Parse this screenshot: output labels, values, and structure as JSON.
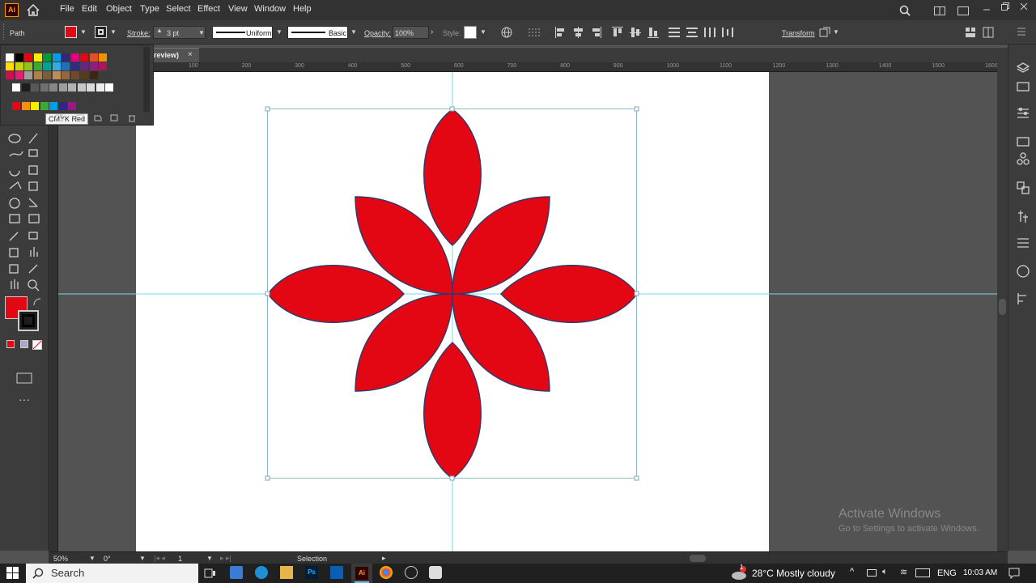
{
  "app": {
    "logo": "Ai",
    "home_icon": "home-icon"
  },
  "menu": [
    "File",
    "Edit",
    "Object",
    "Type",
    "Select",
    "Effect",
    "View",
    "Window",
    "Help"
  ],
  "control": {
    "selection_type": "Path",
    "fill_color": "#e30613",
    "stroke_label": "Stroke:",
    "stroke_weight": "3 pt",
    "profile_label": "Uniform",
    "brush_label": "Basic",
    "opacity_label": "Opacity:",
    "opacity_value": "100%",
    "style_label": "Style:",
    "transform_label": "Transform"
  },
  "document": {
    "tab_label": "review)"
  },
  "ruler": {
    "h_ticks": [
      "100",
      "200",
      "300",
      "400",
      "500",
      "600",
      "700",
      "800",
      "900",
      "1000",
      "1100",
      "1200",
      "1300",
      "1400",
      "1500",
      "1600"
    ]
  },
  "swatches": {
    "tooltip": "CMYK Red",
    "row1": [
      "#ffffff",
      "#000000",
      "#e30613",
      "#ffed00",
      "#00983a",
      "#009fe3",
      "#312783",
      "#e6007e",
      "#e30613",
      "#e94e1b",
      "#f39200"
    ],
    "row2": [
      "#ffdd00",
      "#c8d400",
      "#95c11f",
      "#3aaa35",
      "#00a19a",
      "#36a9e1",
      "#1d71b8",
      "#2d2e83",
      "#662483",
      "#951b81",
      "#a3195b"
    ],
    "row3": [
      "#d60b52",
      "#e71d73",
      "#9d9d9c",
      "#b17f4a",
      "#7c5c3b",
      "#be8d5a",
      "#95673e",
      "#6f4a2c",
      "#5a3a1f",
      "#3c2616"
    ],
    "row4": [
      "#ffffff",
      "#1d1d1b",
      "#575756",
      "#706f6f",
      "#878787",
      "#9d9d9c",
      "#b2b2b2",
      "#c6c6c5",
      "#dadada",
      "#ededed",
      "#ffffff"
    ],
    "row5": [
      "#e30613",
      "#f39200",
      "#ffed00",
      "#3aaa35",
      "#009fe3",
      "#312783",
      "#951b81"
    ]
  },
  "fill_swatch": "#e30613",
  "status": {
    "zoom": "50%",
    "rotation": "0°",
    "artboard_num": "1",
    "tool": "Selection"
  },
  "watermark": {
    "line1": "Activate Windows",
    "line2": "Go to Settings to activate Windows."
  },
  "taskbar": {
    "search_placeholder": "Search",
    "weather": "28°C  Mostly cloudy",
    "lang": "ENG",
    "time": "10:03 AM",
    "notif_count": "1"
  },
  "icons": [
    "search-icon",
    "arrange-icon",
    "maximize-icon",
    "minimize-icon",
    "close-icon",
    "globe-icon",
    "align-icon",
    "layers-icon",
    "properties-icon"
  ]
}
